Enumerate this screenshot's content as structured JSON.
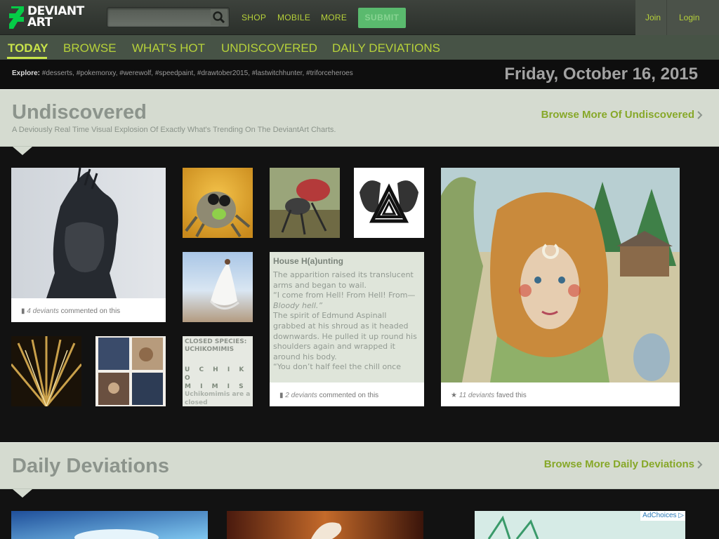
{
  "brand": {
    "line1": "DEVIANT",
    "line2": "ART"
  },
  "search": {
    "placeholder": ""
  },
  "topnav": {
    "shop": "SHOP",
    "mobile": "MOBILE",
    "more": "MORE",
    "submit": "SUBMIT"
  },
  "account": {
    "join": "Join",
    "login": "Login"
  },
  "subnav": {
    "today": "TODAY",
    "browse": "BROWSE",
    "whats_hot": "WHAT'S HOT",
    "undiscovered": "UNDISCOVERED",
    "daily": "DAILY DEVIATIONS"
  },
  "explore": {
    "label": "Explore:",
    "tags": [
      "#desserts",
      "#pokemonxy",
      "#werewolf",
      "#speedpaint",
      "#drawtober2015",
      "#lastwitchhunter",
      "#triforceheroes"
    ]
  },
  "date": "Friday, October 16, 2015",
  "undiscovered": {
    "title": "Undiscovered",
    "subtitle": "A Deviously Real Time Visual Explosion Of Exactly What's Trending On The DeviantArt Charts.",
    "more": "Browse More Of Undiscovered"
  },
  "cards": {
    "portrait": {
      "count": "4 deviants",
      "text": "commented on this"
    },
    "literature": {
      "title": "House H(a)unting",
      "p1": "The apparition raised its translucent arms and began to wail.",
      "p2a": "“I come from Hell! From Hell! From— ",
      "p2b": "Bloody hell.”",
      "p3": "The spirit of Edmund Aspinall grabbed at his shroud as it headed downwards. He pulled it up round his shoulders again and wrapped it around his body.",
      "p4": "“You don’t half feel the chill once",
      "count": "2 deviants",
      "text": "commented on this"
    },
    "closed": {
      "title": "CLOSED SPECIES: UCHIKOMIMIS",
      "spaced1": "U C H I K O",
      "spaced2": "M I M I S",
      "body": "Uchikomimis are a closed"
    },
    "big": {
      "count": "11 deviants",
      "text": "faved this"
    }
  },
  "daily": {
    "title": "Daily Deviations",
    "more": "Browse More Daily Deviations"
  },
  "ad": {
    "label": "AdChoices"
  },
  "colors": {
    "accent": "#b6d13a",
    "submit": "#5aba6e",
    "section_bg": "#d5dbd0"
  }
}
